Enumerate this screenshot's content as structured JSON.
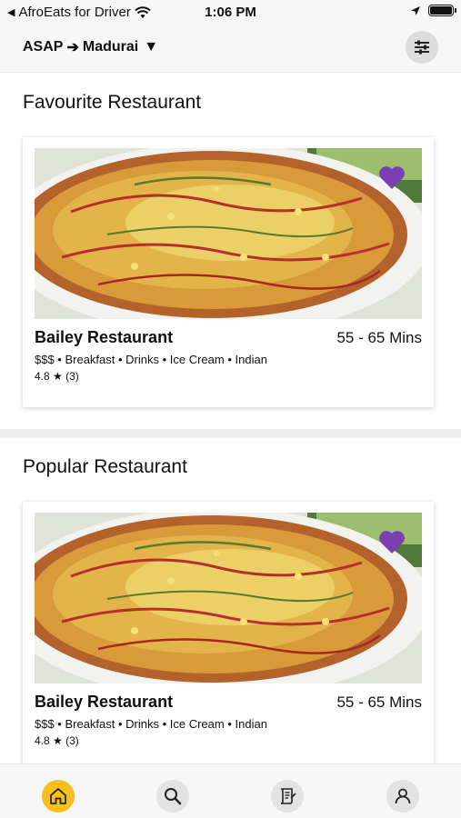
{
  "status_bar": {
    "back_label": "AfroEats for Driver",
    "time": "1:06 PM"
  },
  "header": {
    "schedule": "ASAP",
    "arrow": "➔",
    "city": "Madurai",
    "dropdown": "▼"
  },
  "sections": [
    {
      "title": "Favourite Restaurant",
      "card": {
        "name": "Bailey Restaurant",
        "time": "55 - 65 Mins",
        "tags": "$$$ • Breakfast • Drinks • Ice Cream • Indian",
        "rating": "4.8 ★ (3)"
      }
    },
    {
      "title": "Popular Restaurant",
      "card": {
        "name": "Bailey Restaurant",
        "time": "55 - 65 Mins",
        "tags": "$$$ • Breakfast • Drinks • Ice Cream • Indian",
        "rating": "4.8 ★ (3)"
      }
    }
  ],
  "colors": {
    "heart": "#7a3fb2",
    "home_active": "#f5c01c"
  },
  "bottom_nav": {
    "items": [
      "home-icon",
      "search-icon",
      "orders-icon",
      "profile-icon"
    ]
  }
}
